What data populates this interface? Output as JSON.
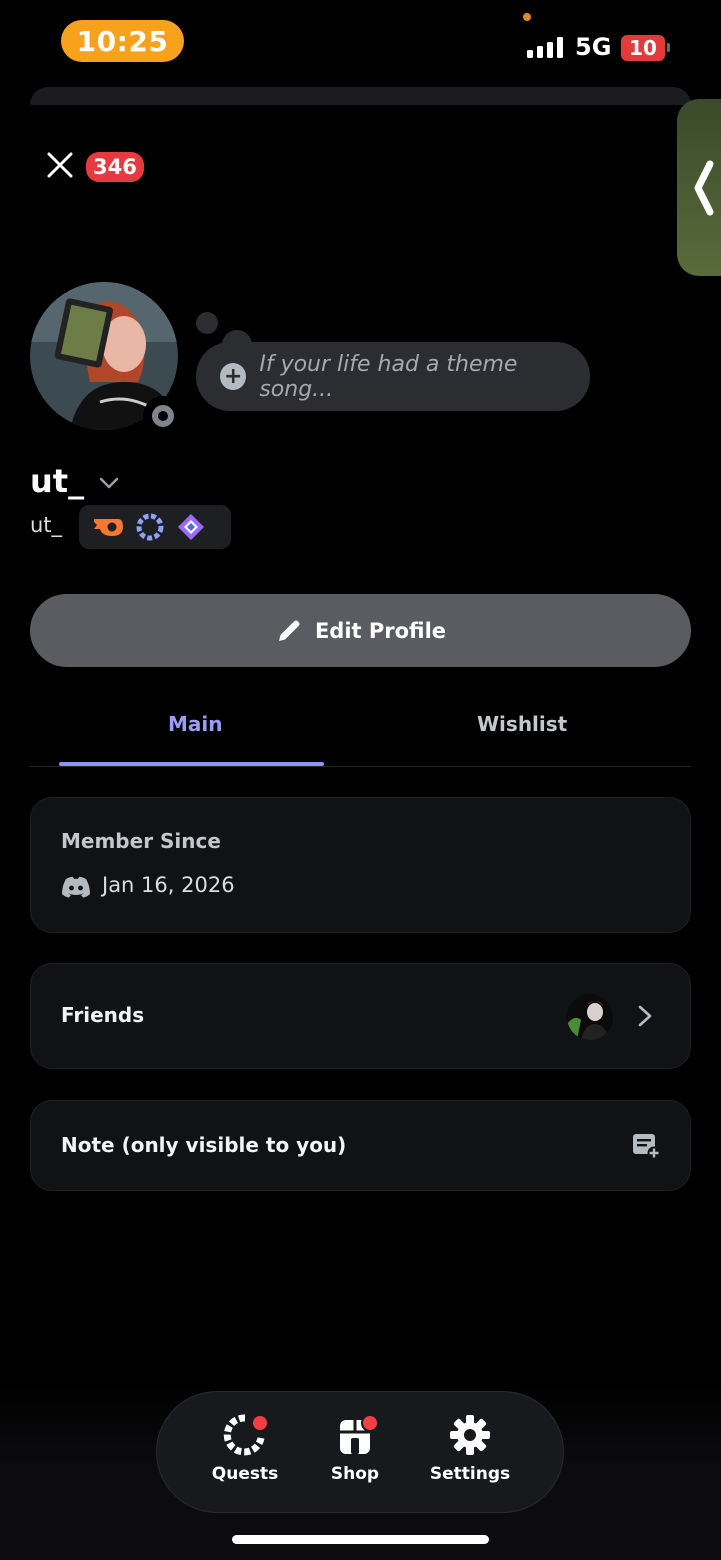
{
  "status_bar": {
    "time": "10:25",
    "network": "5G",
    "battery": "10"
  },
  "header": {
    "close_icon": "close-icon",
    "notification_count": "346"
  },
  "profile": {
    "status_placeholder": "If your life had a theme song...",
    "display_name": "ut_",
    "username": "ut_",
    "badges": [
      "hypesquad-icon",
      "nitro-badge-icon",
      "quest-badge-icon"
    ]
  },
  "actions": {
    "edit_profile_label": "Edit Profile"
  },
  "tabs": [
    {
      "label": "Main",
      "active": true
    },
    {
      "label": "Wishlist",
      "active": false
    }
  ],
  "member_since": {
    "title": "Member Since",
    "date": "Jan 16, 2026"
  },
  "friends": {
    "label": "Friends"
  },
  "note": {
    "label": "Note (only visible to you)"
  },
  "bottom_nav": [
    {
      "label": "Quests",
      "icon": "quests-icon",
      "has_dot": true
    },
    {
      "label": "Shop",
      "icon": "shop-icon",
      "has_dot": true
    },
    {
      "label": "Settings",
      "icon": "gear-icon",
      "has_dot": false
    }
  ],
  "colors": {
    "accent": "#8e93f0",
    "badge_red": "#e63a40",
    "time_pill": "#f8a21b"
  }
}
